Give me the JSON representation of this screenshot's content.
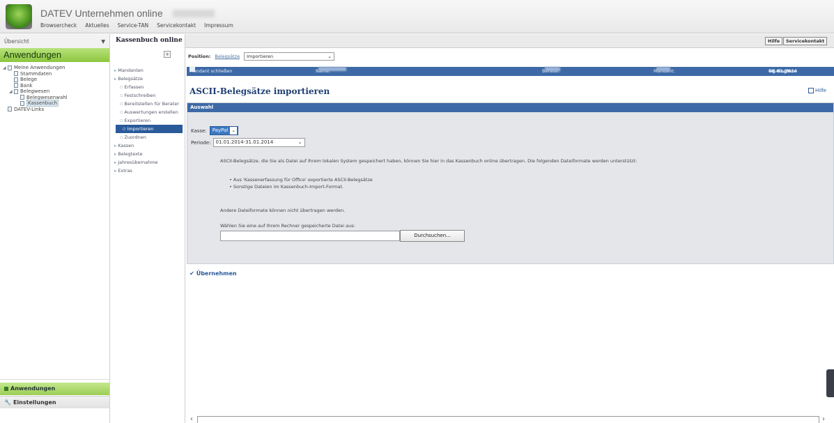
{
  "header": {
    "app_title": "DATEV Unternehmen online",
    "nav": [
      "Browsercheck",
      "Aktuelles",
      "Service-TAN",
      "Servicekontakt",
      "Impressum"
    ]
  },
  "left": {
    "top_label": "Übersicht",
    "heading": "Anwendungen",
    "tree": [
      {
        "label": "Meine Anwendungen",
        "level": 0,
        "expander": "◢"
      },
      {
        "label": "Stammdaten",
        "level": 1
      },
      {
        "label": "Belege",
        "level": 1
      },
      {
        "label": "Bank",
        "level": 1
      },
      {
        "label": "Belegwesen",
        "level": 1,
        "expander": "◢"
      },
      {
        "label": "Belegwesenwahl",
        "level": 2
      },
      {
        "label": "Kassenbuch",
        "level": 2,
        "selected": true
      },
      {
        "label": "DATEV-Links",
        "level": 0
      }
    ],
    "bottom_nav": {
      "apps": "Anwendungen",
      "settings": "Einstellungen"
    }
  },
  "mid": {
    "title": "Kassenbuch online",
    "toggle": "+",
    "items": [
      {
        "label": "Mandanten",
        "type": "top"
      },
      {
        "label": "Belegsätze",
        "type": "top"
      },
      {
        "label": "Erfassen",
        "type": "sub"
      },
      {
        "label": "Festschreiben",
        "type": "sub"
      },
      {
        "label": "Bereitstellen für Berater",
        "type": "sub",
        "wrap": true
      },
      {
        "label": "Auswertungen erstellen",
        "type": "sub",
        "wrap": true
      },
      {
        "label": "Exportieren",
        "type": "sub"
      },
      {
        "label": "Importieren",
        "type": "sub",
        "active": true
      },
      {
        "label": "Zuordnen",
        "type": "sub"
      },
      {
        "label": "Kassen",
        "type": "top"
      },
      {
        "label": "Belegtexte",
        "type": "top"
      },
      {
        "label": "Jahresübernahme",
        "type": "top"
      },
      {
        "label": "Extras",
        "type": "top"
      }
    ]
  },
  "toolbar": {
    "help": "Hilfe",
    "service": "Servicekontakt"
  },
  "position": {
    "label": "Position:",
    "crumb": "Belegsätze",
    "select_value": "Importieren",
    "select_arrow": "❯"
  },
  "infobar": {
    "close_label": "Mandant schließen",
    "name_label": "Name:",
    "berater_label": "Berater:",
    "mandant_label": "Mandant:",
    "wj_label": "WJ-Beginn:",
    "wj_value": "01.01.2014"
  },
  "page": {
    "title": "ASCII-Belegsätze importieren",
    "help_link": "Hilfe"
  },
  "panel": {
    "heading": "Auswahl",
    "kasse_label": "Kasse:",
    "kasse_value": "PayPal",
    "periode_label": "Periode:",
    "periode_value": "01.01.2014-31.01.2014",
    "intro": "ASCII-Belegsätze, die Sie als Datei auf Ihrem lokalen System gespeichert haben, können Sie hier in das Kassenbuch online übertragen. Die folgenden Dateiformate werden unterstützt:",
    "formats": [
      "Aus 'Kassenerfassung für Office' exportierte ASCII-Belegsätze",
      "Sonstige Dateien im Kassenbuch-Import-Format."
    ],
    "other_formats": "Andere Dateiformate können nicht übertragen werden.",
    "file_prompt": "Wählen Sie eine auf Ihrem Rechner gespeicherte Datei aus:",
    "browse": "Durchsuchen..."
  },
  "apply": {
    "label": "Übernehmen",
    "check": "✔"
  }
}
